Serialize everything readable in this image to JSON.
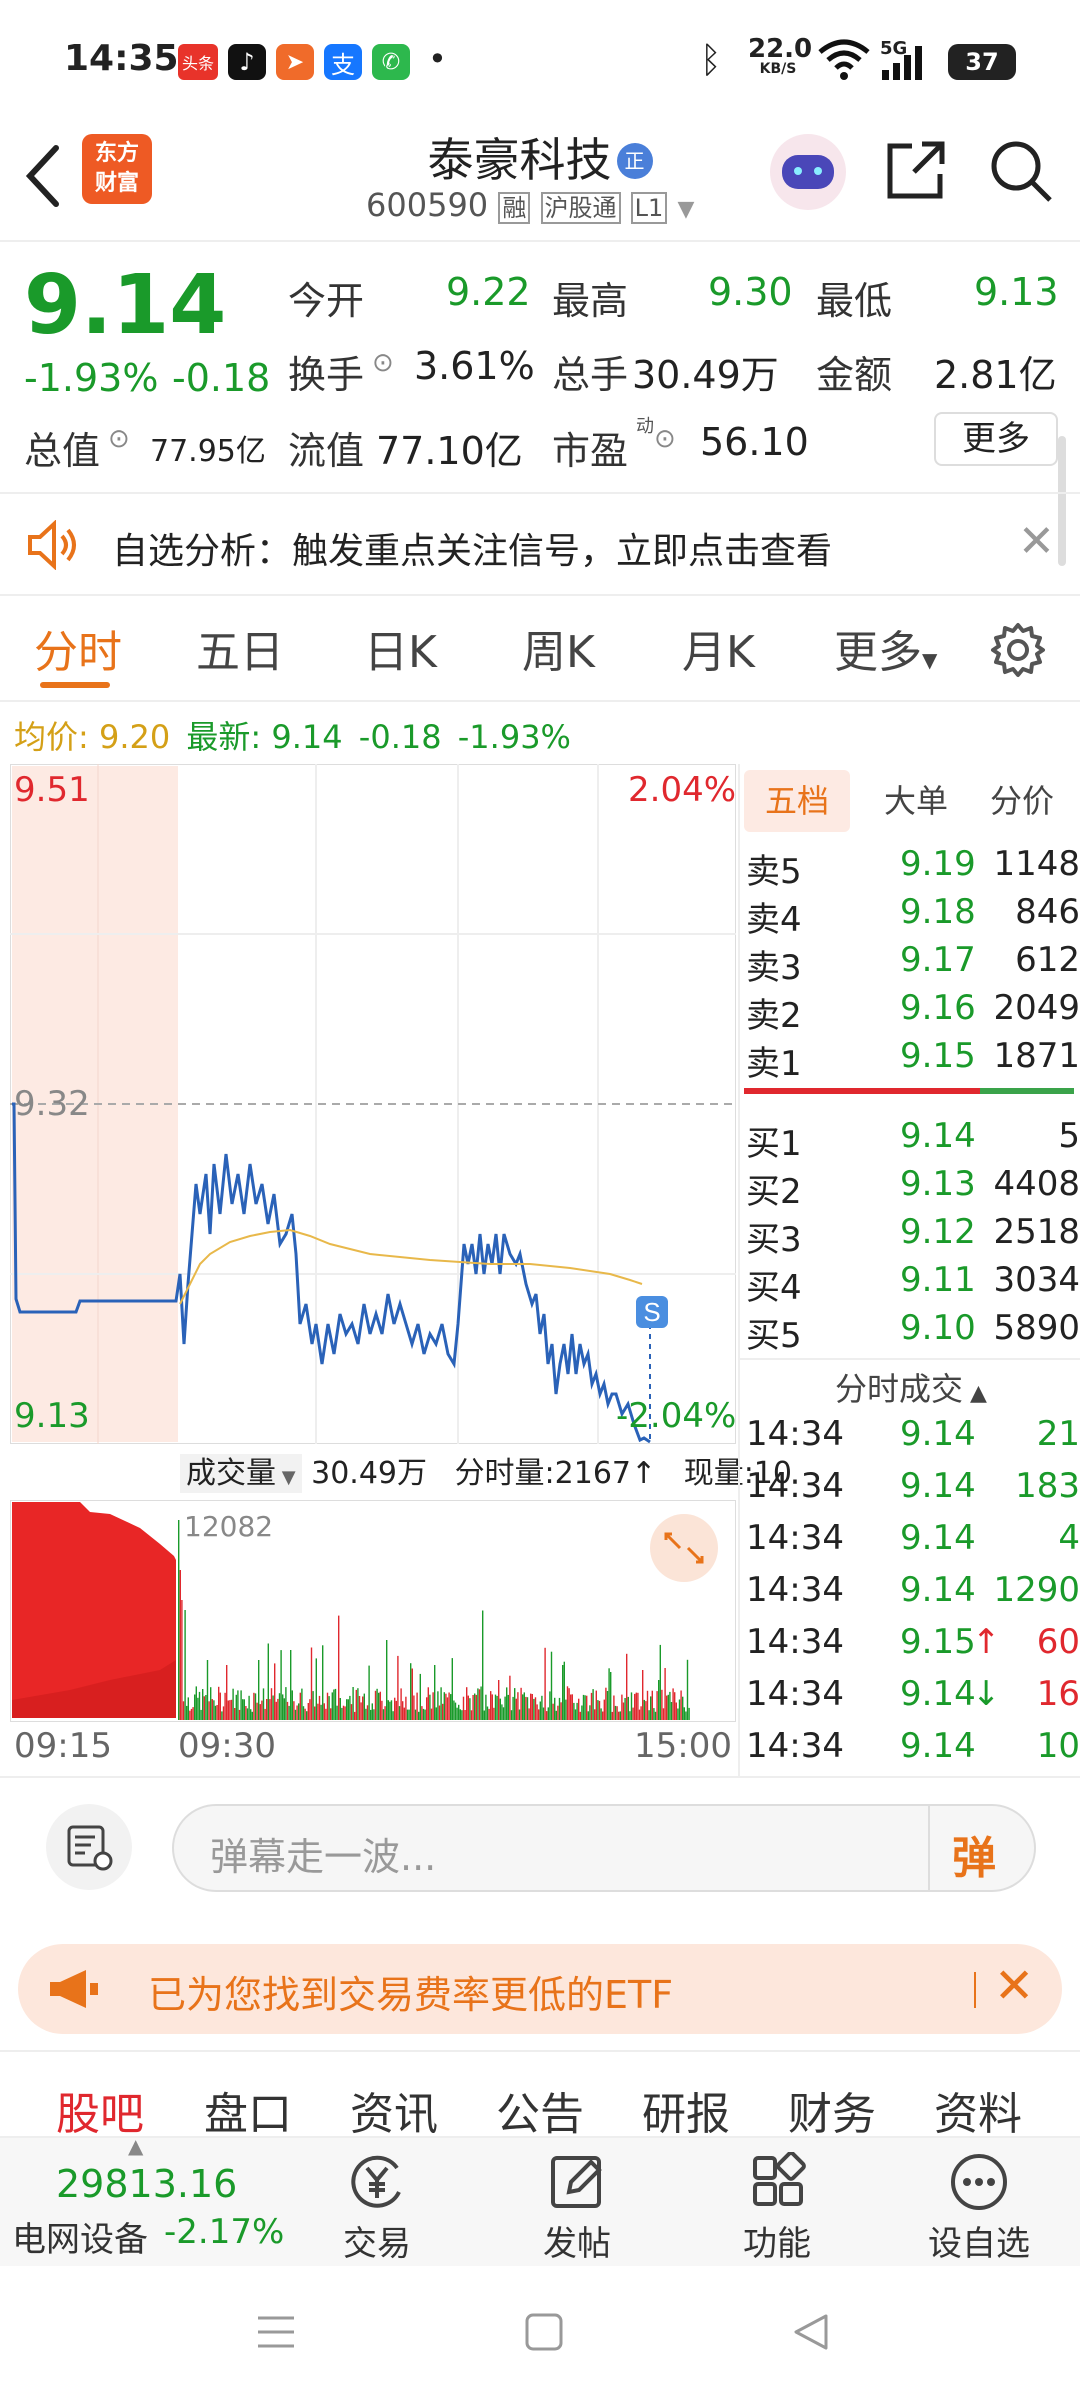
{
  "status_bar": {
    "time": "14:35",
    "net_speed_value": "22.0",
    "net_speed_unit": "KB/S",
    "network": "5G",
    "battery": "37",
    "app_icons": [
      "toutiao-icon",
      "tiktok-icon",
      "xiaohongshu-icon",
      "alipay-icon",
      "phone-icon"
    ],
    "notif_dot": "•"
  },
  "header": {
    "title": "泰豪科技",
    "title_badge": "正",
    "code": "600590",
    "tags": [
      "融",
      "沪股通",
      "L1"
    ],
    "logo_line1": "东方",
    "logo_line2": "财富"
  },
  "quote": {
    "price": "9.14",
    "change_pct": "-1.93%",
    "change": "-0.18",
    "open_label": "今开",
    "open": "9.22",
    "high_label": "最高",
    "high": "9.30",
    "low_label": "最低",
    "low": "9.13",
    "turnover_label": "换手",
    "turnover": "3.61%",
    "volume_label": "总手",
    "volume": "30.49万",
    "amount_label": "金额",
    "amount": "2.81亿",
    "mcap_label": "总值",
    "mcap": "77.95亿",
    "float_label": "流值",
    "float": "77.10亿",
    "pe_label": "市盈",
    "pe_sup": "动",
    "pe": "56.10",
    "more_btn": "更多"
  },
  "banner": {
    "text": "自选分析：触发重点关注信号，立即点击查看"
  },
  "chart_tabs": [
    "分时",
    "五日",
    "日K",
    "周K",
    "月K",
    "更多"
  ],
  "avg_line": {
    "avg_label": "均价:",
    "avg": "9.20",
    "latest_label": "最新:",
    "latest": "9.14",
    "chg": "-0.18",
    "chg_pct": "-1.93%"
  },
  "chart_labels": {
    "top_price": "9.51",
    "top_pct": "2.04%",
    "mid_price": "9.32",
    "bottom_price": "9.13",
    "bottom_pct": "-2.04%",
    "s_marker": "S"
  },
  "volume_bar": {
    "label": "成交量",
    "total": "30.49万",
    "minute": "分时量:2167↑",
    "current": "现量:10",
    "peak": "12082"
  },
  "time_axis": [
    "09:15",
    "09:30",
    "15:00"
  ],
  "orderbook": {
    "tabs": [
      "五档",
      "大单",
      "分价"
    ],
    "sells": [
      {
        "label": "卖5",
        "price": "9.19",
        "vol": "1148"
      },
      {
        "label": "卖4",
        "price": "9.18",
        "vol": "846"
      },
      {
        "label": "卖3",
        "price": "9.17",
        "vol": "612"
      },
      {
        "label": "卖2",
        "price": "9.16",
        "vol": "2049"
      },
      {
        "label": "卖1",
        "price": "9.15",
        "vol": "1871"
      }
    ],
    "buys": [
      {
        "label": "买1",
        "price": "9.14",
        "vol": "5"
      },
      {
        "label": "买2",
        "price": "9.13",
        "vol": "4408"
      },
      {
        "label": "买3",
        "price": "9.12",
        "vol": "2518"
      },
      {
        "label": "买4",
        "price": "9.11",
        "vol": "3034"
      },
      {
        "label": "买5",
        "price": "9.10",
        "vol": "5890"
      }
    ],
    "trades_title": "分时成交",
    "trades": [
      {
        "time": "14:34",
        "price": "9.14",
        "vol": "21",
        "arrow": ""
      },
      {
        "time": "14:34",
        "price": "9.14",
        "vol": "183",
        "arrow": ""
      },
      {
        "time": "14:34",
        "price": "9.14",
        "vol": "4",
        "arrow": ""
      },
      {
        "time": "14:34",
        "price": "9.14",
        "vol": "1290",
        "arrow": ""
      },
      {
        "time": "14:34",
        "price": "9.15",
        "vol": "60",
        "arrow": "↑"
      },
      {
        "time": "14:34",
        "price": "9.14",
        "vol": "16",
        "arrow": "↓"
      },
      {
        "time": "14:34",
        "price": "9.14",
        "vol": "10",
        "arrow": ""
      }
    ]
  },
  "danmaku": {
    "placeholder": "弹幕走一波...",
    "send_icon_label": "弹"
  },
  "etf_banner": {
    "text": "已为您找到交易费率更低的ETF"
  },
  "info_tabs": [
    "股吧",
    "盘口",
    "资讯",
    "公告",
    "研报",
    "财务",
    "资料"
  ],
  "bottom_nav": {
    "index_value": "29813.16",
    "sector": "电网设备",
    "sector_chg": "-2.17%",
    "items": [
      "交易",
      "发帖",
      "功能",
      "设自选"
    ]
  },
  "colors": {
    "green": "#1a9a2a",
    "red": "#e0282e",
    "accent": "#e8731a"
  }
}
